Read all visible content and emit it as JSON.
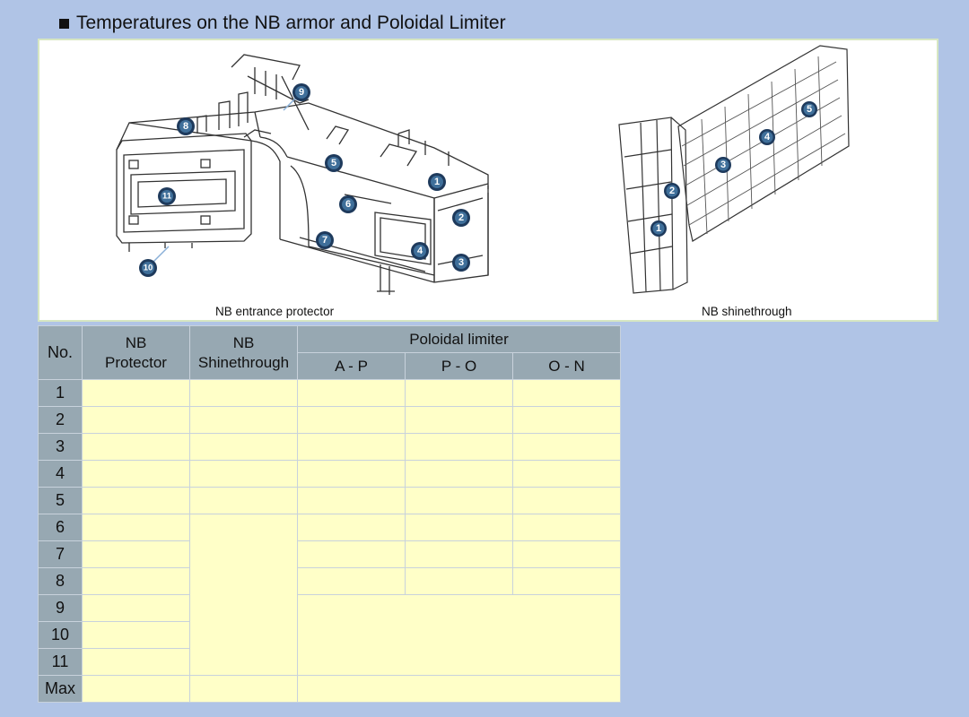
{
  "title": "Temperatures on the NB armor and Poloidal Limiter",
  "figure": {
    "left_caption": "NB entrance protector",
    "right_caption": "NB shinethrough",
    "left_markers": [
      "1",
      "2",
      "3",
      "4",
      "5",
      "6",
      "7",
      "8",
      "9",
      "10",
      "11"
    ],
    "right_markers": [
      "1",
      "2",
      "3",
      "4",
      "5"
    ]
  },
  "table": {
    "headers": {
      "no": "No.",
      "nb_protector_1": "NB",
      "nb_protector_2": "Protector",
      "nb_shine_1": "NB",
      "nb_shine_2": "Shinethrough",
      "poloidal": "Poloidal limiter",
      "ap": "A - P",
      "po": "P - O",
      "on": "O - N"
    },
    "rows": [
      "1",
      "2",
      "3",
      "4",
      "5",
      "6",
      "7",
      "8",
      "9",
      "10",
      "11",
      "Max"
    ]
  },
  "colors": {
    "background": "#b0c4e6",
    "header": "#97a8b2",
    "cell": "#ffffc8",
    "marker": "#1e3a5c"
  }
}
